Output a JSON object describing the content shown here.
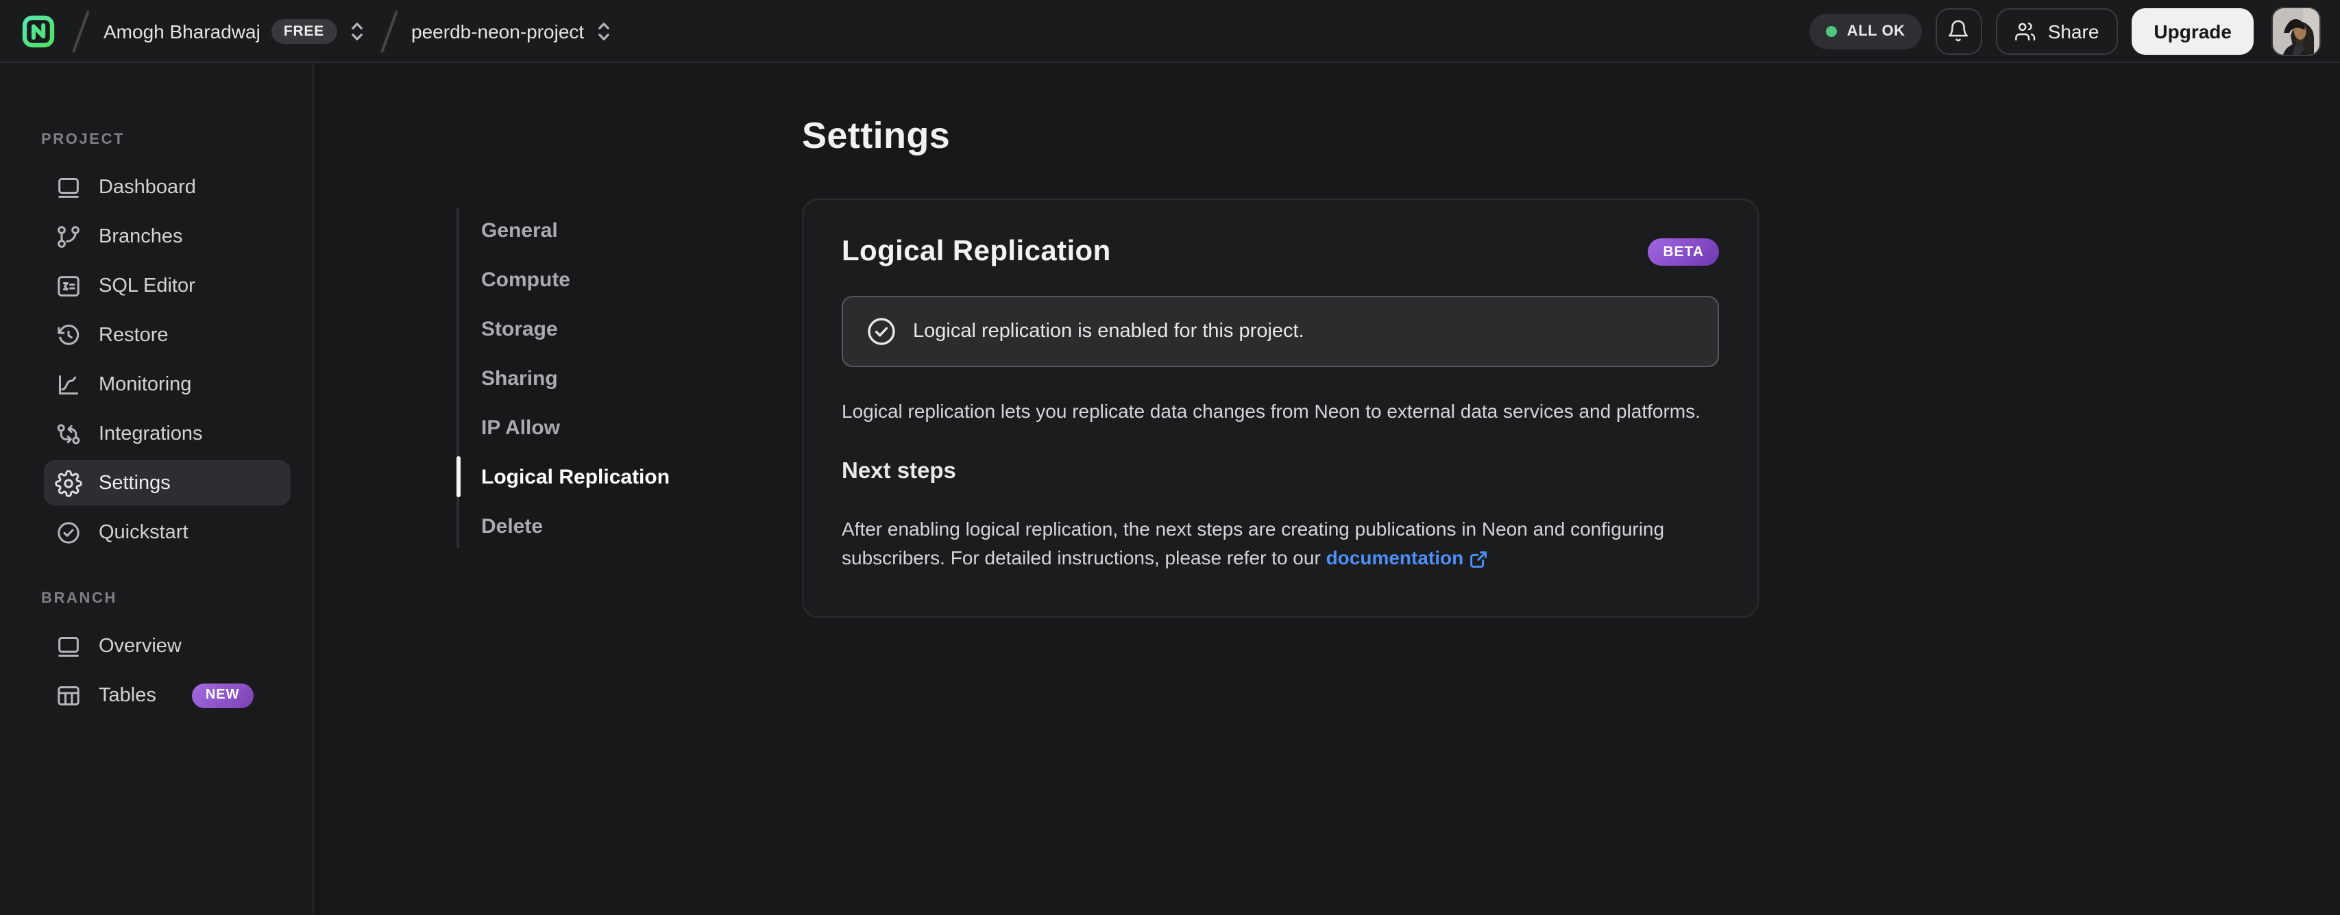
{
  "topbar": {
    "org_name": "Amogh Bharadwaj",
    "plan_badge": "FREE",
    "project_name": "peerdb-neon-project",
    "status_label": "ALL OK",
    "share_label": "Share",
    "upgrade_label": "Upgrade"
  },
  "sidebar": {
    "project_section_label": "PROJECT",
    "project_items": [
      {
        "label": "Dashboard"
      },
      {
        "label": "Branches"
      },
      {
        "label": "SQL Editor"
      },
      {
        "label": "Restore"
      },
      {
        "label": "Monitoring"
      },
      {
        "label": "Integrations"
      },
      {
        "label": "Settings",
        "state": "active"
      },
      {
        "label": "Quickstart"
      }
    ],
    "branch_section_label": "BRANCH",
    "branch_items": [
      {
        "label": "Overview"
      },
      {
        "label": "Tables",
        "badge": "NEW"
      }
    ]
  },
  "settings_nav": {
    "items": [
      {
        "label": "General"
      },
      {
        "label": "Compute"
      },
      {
        "label": "Storage"
      },
      {
        "label": "Sharing"
      },
      {
        "label": "IP Allow"
      },
      {
        "label": "Logical Replication",
        "state": "active"
      },
      {
        "label": "Delete"
      }
    ]
  },
  "main": {
    "title": "Settings"
  },
  "card": {
    "title": "Logical Replication",
    "badge": "BETA",
    "alert_text": "Logical replication is enabled for this project.",
    "description": "Logical replication lets you replicate data changes from Neon to external data services and platforms.",
    "next_steps_title": "Next steps",
    "next_steps_text": "After enabling logical replication, the next steps are creating publications in Neon and configuring subscribers. For detailed instructions, please refer to our ",
    "doc_link_label": "documentation"
  },
  "colors": {
    "brand_gradient_start": "#5ce7c0",
    "brand_gradient_end": "#4de04f",
    "accent_green_check": "#47d7a1",
    "status_dot_green": "#4fc580",
    "badge_purple_start": "#a266e2",
    "badge_purple_end": "#7038b0",
    "link_blue": "#4e8ef7"
  }
}
